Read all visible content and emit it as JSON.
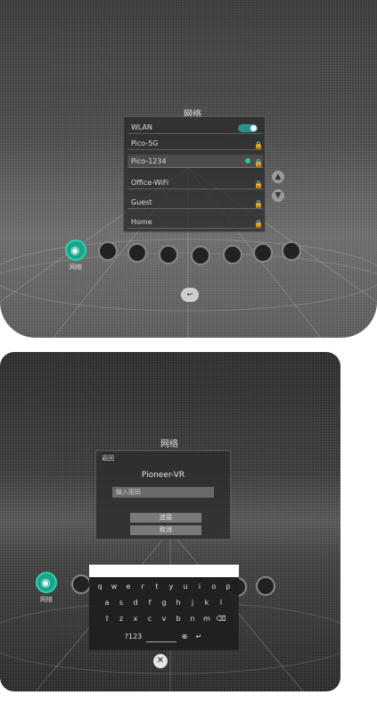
{
  "screen1": {
    "title": "网络",
    "networks": [
      {
        "name": "WLAN",
        "lock": "",
        "toggle": true
      },
      {
        "name": "Pico-5G",
        "lock": "🔒"
      },
      {
        "name": "Pico-1234",
        "lock": "🔒",
        "selected": true
      },
      {
        "name": "Office-WiFi",
        "lock": "🔒"
      },
      {
        "name": "Guest",
        "lock": "🔒"
      },
      {
        "name": "Home",
        "lock": "🔒"
      }
    ],
    "scroll_up": "▲",
    "scroll_down": "▼",
    "dock_label": "网络",
    "back_label": "↩"
  },
  "screen2": {
    "title": "网络",
    "back_label": "返回",
    "ssid": "Pioneer-VR",
    "password_placeholder": "输入密码",
    "connect_label": "连接",
    "cancel_label": "取消",
    "dock_label": "网络",
    "keyboard": {
      "row1": [
        "q",
        "w",
        "e",
        "r",
        "t",
        "y",
        "u",
        "i",
        "o",
        "p"
      ],
      "row2": [
        "a",
        "s",
        "d",
        "f",
        "g",
        "h",
        "j",
        "k",
        "l"
      ],
      "row3": [
        "⇧",
        "z",
        "x",
        "c",
        "v",
        "b",
        "n",
        "m",
        "⌫"
      ],
      "row4": [
        "?123",
        "",
        "⊕",
        "↵"
      ]
    },
    "close_label": "✕"
  },
  "colors": {
    "accent": "#1aa58a",
    "toggle": "#2d8f8f"
  }
}
